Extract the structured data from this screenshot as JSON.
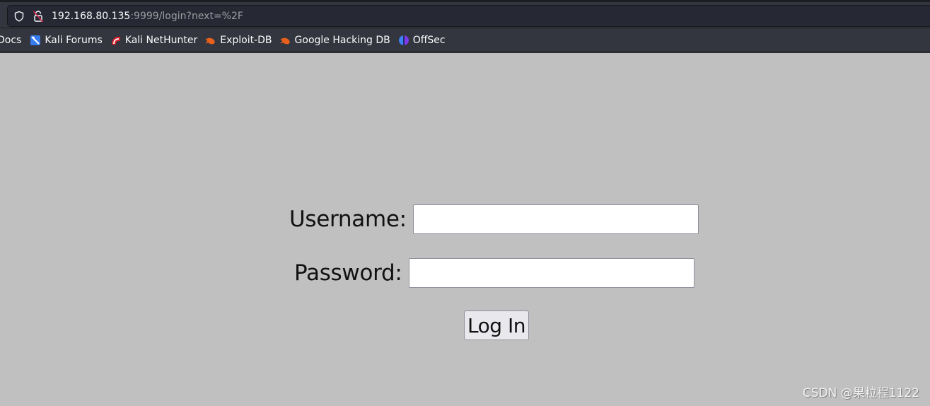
{
  "browser": {
    "url_host": "192.168.80.135",
    "url_rest": ":9999/login?next=%2F",
    "icons": {
      "tracking": "shield-icon",
      "security": "insecure-lock-icon"
    },
    "bookmarks": [
      {
        "label": "Docs",
        "icon": "none"
      },
      {
        "label": "Kali Forums",
        "icon": "kali-forums-icon"
      },
      {
        "label": "Kali NetHunter",
        "icon": "kali-nethunter-icon"
      },
      {
        "label": "Exploit-DB",
        "icon": "exploit-db-icon"
      },
      {
        "label": "Google Hacking DB",
        "icon": "exploit-db-icon"
      },
      {
        "label": "OffSec",
        "icon": "offsec-icon"
      }
    ]
  },
  "login": {
    "username_label": "Username:",
    "username_value": "",
    "password_label": "Password:",
    "password_value": "",
    "submit_label": "Log In"
  },
  "watermark": "CSDN @果粒程1122",
  "colors": {
    "page_bg": "#c0c0c0",
    "chrome_bg": "#33363e",
    "urlbar_bg": "#262833"
  }
}
